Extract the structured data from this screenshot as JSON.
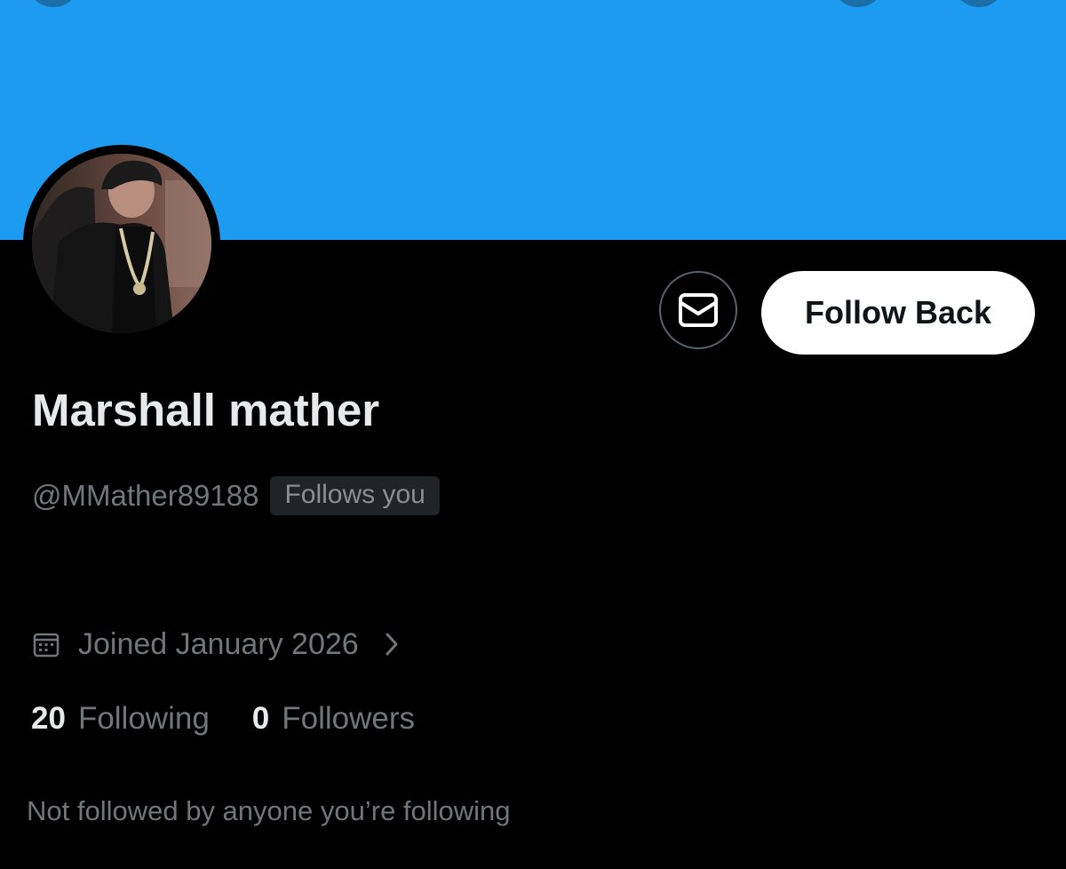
{
  "profile": {
    "display_name": "Marshall mather",
    "handle": "@MMather89188",
    "follows_you_badge": "Follows you",
    "joined": "Joined January 2026",
    "following_count": "20",
    "following_label": "Following",
    "followers_count": "0",
    "followers_label": "Followers",
    "not_followed_note": "Not followed by anyone you’re following"
  },
  "actions": {
    "message_icon": "envelope-icon",
    "follow_back_label": "Follow Back"
  },
  "icons": {
    "calendar": "calendar-icon",
    "chevron": "chevron-right-icon"
  },
  "colors": {
    "banner": "#1d9bf0",
    "background": "#000000",
    "primary_text": "#e7e9ea",
    "secondary_text": "#71767b",
    "button_bg": "#ffffff",
    "button_text": "#0f1419",
    "badge_bg": "#202327"
  }
}
